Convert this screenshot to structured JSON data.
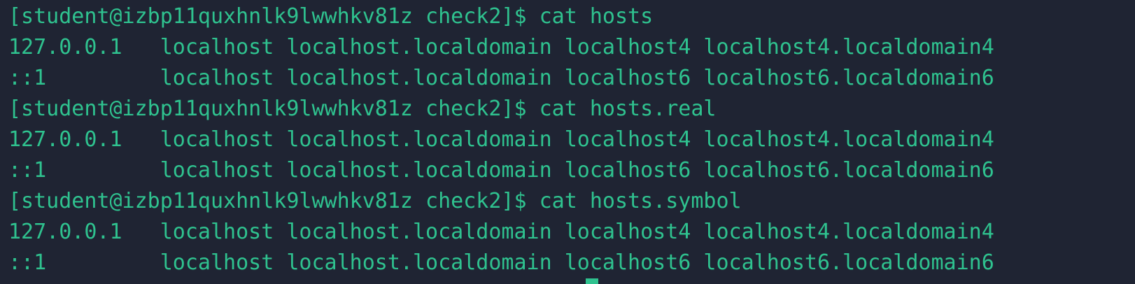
{
  "terminal": {
    "lines": [
      "[student@izbp11quxhnlk9lwwhkv81z check2]$ cat hosts",
      "127.0.0.1   localhost localhost.localdomain localhost4 localhost4.localdomain4",
      "::1         localhost localhost.localdomain localhost6 localhost6.localdomain6",
      "[student@izbp11quxhnlk9lwwhkv81z check2]$ cat hosts.real",
      "127.0.0.1   localhost localhost.localdomain localhost4 localhost4.localdomain4",
      "::1         localhost localhost.localdomain localhost6 localhost6.localdomain6",
      "[student@izbp11quxhnlk9lwwhkv81z check2]$ cat hosts.symbol",
      "127.0.0.1   localhost localhost.localdomain localhost4 localhost4.localdomain4",
      "::1         localhost localhost.localdomain localhost6 localhost6.localdomain6"
    ]
  },
  "colors": {
    "background": "#1f2433",
    "text": "#2fc28f"
  }
}
